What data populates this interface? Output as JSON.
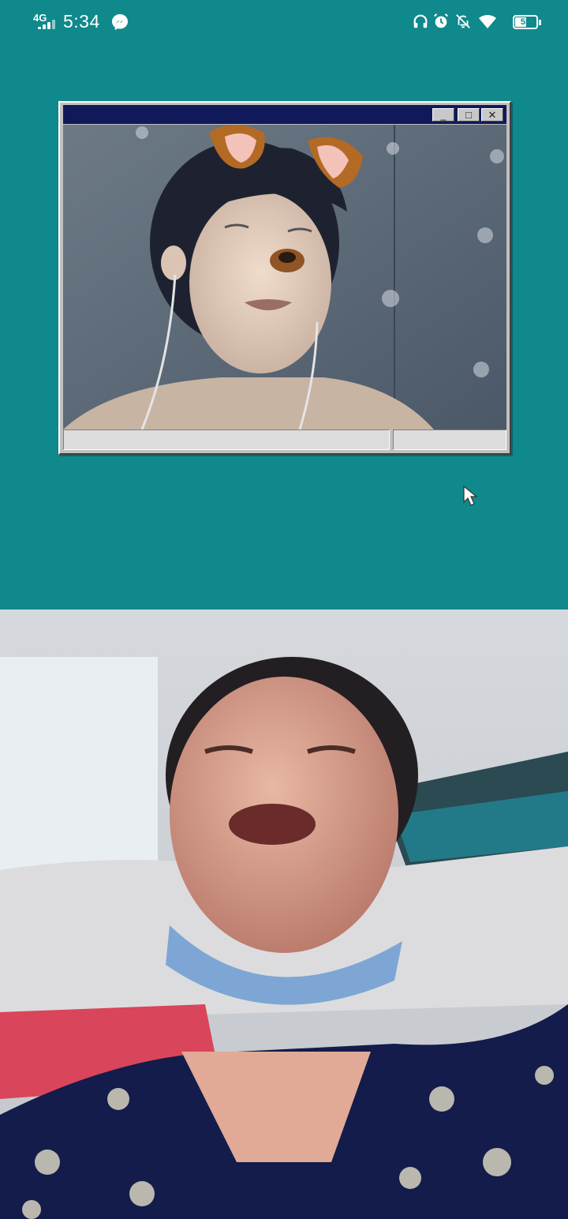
{
  "status_bar": {
    "network": "4G",
    "time": "5:34",
    "battery": "55",
    "icons": [
      "signal-icon",
      "messenger-icon",
      "headphones-icon",
      "alarm-icon",
      "bell-off-icon",
      "wifi-icon",
      "battery-icon"
    ]
  },
  "window": {
    "title": "",
    "controls": [
      "_",
      "□",
      "✕"
    ]
  },
  "colors": {
    "background": "#0f898c",
    "title_bar": "#101a5a",
    "window_frame": "#c0c0c0"
  },
  "local_video": {
    "effect": "dog-ears-filter"
  },
  "remote_video": {}
}
